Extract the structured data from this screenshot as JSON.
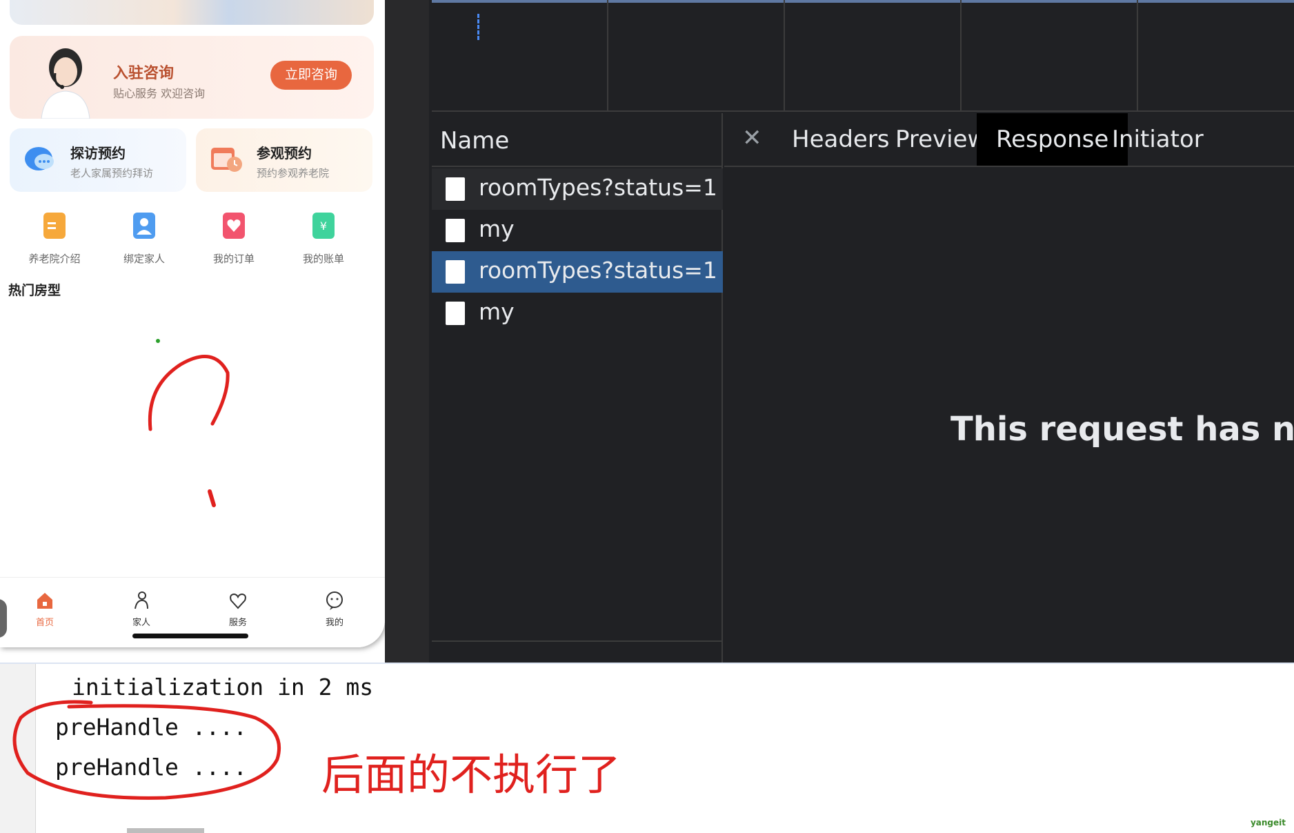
{
  "phone": {
    "consult": {
      "title": "入驻咨询",
      "subtitle": "贴心服务 欢迎咨询",
      "button": "立即咨询"
    },
    "cards": [
      {
        "title": "探访预约",
        "subtitle": "老人家属预约拜访",
        "icon": "chat-bubble-icon"
      },
      {
        "title": "参观预约",
        "subtitle": "预约参观养老院",
        "icon": "calendar-clock-icon"
      }
    ],
    "quick_actions": [
      {
        "label": "养老院介绍",
        "icon": "document-icon",
        "color": "#f6a83b"
      },
      {
        "label": "绑定家人",
        "icon": "user-card-icon",
        "color": "#4f9cf0"
      },
      {
        "label": "我的订单",
        "icon": "heart-card-icon",
        "color": "#f2546e"
      },
      {
        "label": "我的账单",
        "icon": "yuan-bill-icon",
        "color": "#3fd39c"
      }
    ],
    "section_title": "热门房型",
    "tabs": [
      {
        "label": "首页",
        "icon": "home-icon",
        "active": true
      },
      {
        "label": "家人",
        "icon": "family-icon",
        "active": false
      },
      {
        "label": "服务",
        "icon": "heart-hands-icon",
        "active": false
      },
      {
        "label": "我的",
        "icon": "smile-face-icon",
        "active": false
      }
    ],
    "accent_color": "#e8673f"
  },
  "devtools": {
    "name_header": "Name",
    "requests": [
      "roomTypes?status=1",
      "my",
      "roomTypes?status=1",
      "my"
    ],
    "selected_index": 2,
    "tabs": [
      "Headers",
      "Preview",
      "Response",
      "Initiator"
    ],
    "active_tab": "Response",
    "response_message": "This request has nc"
  },
  "console": {
    "lines": [
      "initialization in 2 ms",
      "preHandle ....",
      "preHandle ...."
    ],
    "annotation": "后面的不执行了"
  },
  "watermark": "yangeit"
}
